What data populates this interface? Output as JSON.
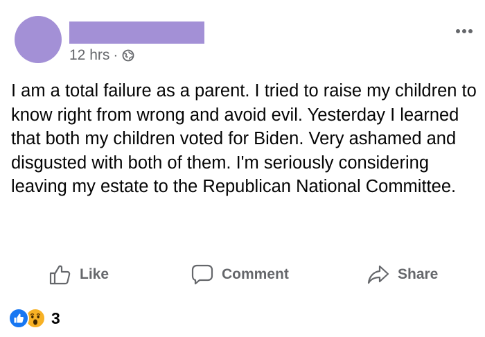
{
  "post": {
    "time": "12 hrs",
    "separator": "·",
    "audience_icon": "globe-icon",
    "text": "I am a total failure as a parent. I tried to raise my children to know right from wrong and avoid evil. Yesterday I learned that both my children voted for Biden. Very ashamed and disgusted with both of them. I'm seriously considering leaving my estate to the Republican National Committee."
  },
  "actions": {
    "like_label": "Like",
    "comment_label": "Comment",
    "share_label": "Share"
  },
  "reactions": {
    "icons": [
      "like-icon",
      "wow-icon"
    ],
    "count": "3"
  },
  "colors": {
    "redaction": "#a390d6",
    "meta_text": "#65676b",
    "like_blue": "#1877f2",
    "wow_yellow": "#f7b125"
  }
}
